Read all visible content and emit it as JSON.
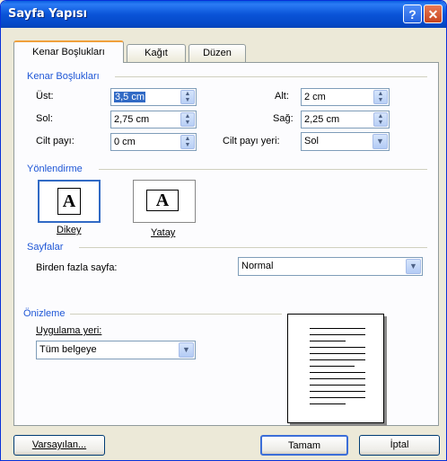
{
  "window": {
    "title": "Sayfa Yapısı",
    "help_glyph": "?",
    "close_glyph": "✕"
  },
  "tabs": [
    {
      "label": "Kenar Boşlukları",
      "active": true
    },
    {
      "label": "Kağıt",
      "active": false
    },
    {
      "label": "Düzen",
      "active": false
    }
  ],
  "margins": {
    "group_title": "Kenar Boşlukları",
    "top": {
      "label": "Üst:",
      "value": "3,5 cm"
    },
    "bottom": {
      "label": "Alt:",
      "value": "2 cm"
    },
    "left": {
      "label": "Sol:",
      "value": "2,75 cm"
    },
    "right": {
      "label": "Sağ:",
      "value": "2,25 cm"
    },
    "gutter": {
      "label": "Cilt payı:",
      "value": "0 cm"
    },
    "gutter_position": {
      "label": "Cilt payı yeri:",
      "value": "Sol"
    }
  },
  "orientation": {
    "group_title": "Yönlendirme",
    "portrait": {
      "label": "Dikey",
      "glyph": "A",
      "selected": true
    },
    "landscape": {
      "label": "Yatay",
      "glyph": "A",
      "selected": false
    }
  },
  "pages": {
    "group_title": "Sayfalar",
    "multiple_pages_label": "Birden fazla sayfa:",
    "multiple_pages_value": "Normal"
  },
  "preview": {
    "group_title": "Önizleme",
    "apply_to_label": "Uygulama yeri:",
    "apply_to_value": "Tüm belgeye"
  },
  "buttons": {
    "default": "Varsayılan...",
    "ok": "Tamam",
    "cancel": "İptal"
  },
  "colors": {
    "title_bar": "#0a54d8",
    "group_title": "#1e56d6",
    "selection": "#316ac5"
  }
}
